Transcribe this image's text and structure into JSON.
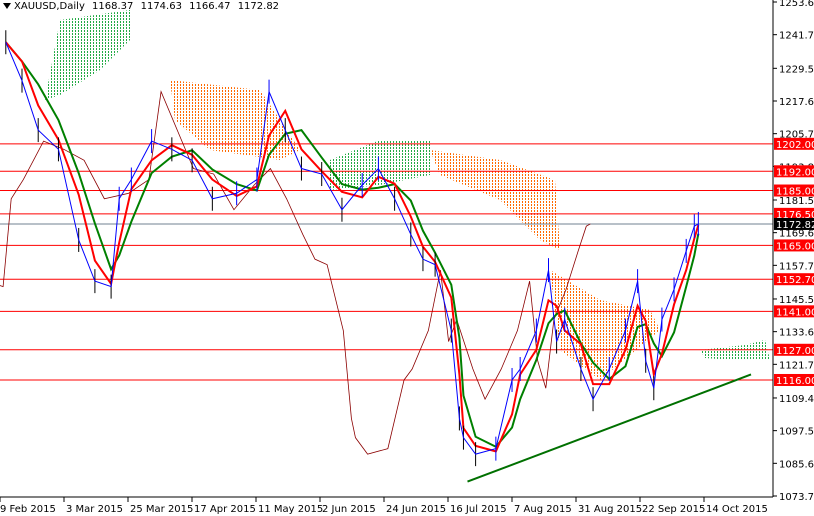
{
  "header": {
    "symbol": "XAUUSD,Daily",
    "open": "1168.37",
    "high": "1174.63",
    "low": "1166.47",
    "close": "1172.82"
  },
  "chart_data": {
    "type": "line",
    "title": "XAUUSD,Daily",
    "ylim": [
      1073.75,
      1253.65
    ],
    "y_ticks": [
      "1253.65",
      "1241.75",
      "1229.50",
      "1217.60",
      "1205.70",
      "1193.80",
      "1181.55",
      "1169.65",
      "1157.75",
      "1145.50",
      "1133.60",
      "1121.70",
      "1109.45",
      "1097.55",
      "1085.65",
      "1073.75"
    ],
    "x_ticks": [
      "9 Feb 2015",
      "3 Mar 2015",
      "25 Mar 2015",
      "17 Apr 2015",
      "11 May 2015",
      "2 Jun 2015",
      "24 Jun 2015",
      "16 Jul 2015",
      "7 Aug 2015",
      "31 Aug 2015",
      "22 Sep 2015",
      "14 Oct 2015"
    ],
    "levels": [
      "1202.00",
      "1192.00",
      "1185.00",
      "1176.50",
      "1165.00",
      "1152.70",
      "1141.00",
      "1127.00",
      "1116.00"
    ],
    "current_price": "1172.82",
    "price_series": {
      "name": "XAUUSD close (approx.)",
      "bar_index": [
        -4,
        0,
        4,
        9,
        14,
        18,
        22,
        24,
        27,
        32,
        37,
        42,
        47,
        53,
        58,
        61,
        65,
        69,
        74,
        79,
        84,
        88,
        92,
        96,
        99,
        102,
        106,
        108,
        109,
        112,
        117,
        121,
        123,
        127,
        130,
        132,
        134,
        138,
        141,
        145,
        149,
        152,
        154,
        156,
        158,
        161,
        164,
        166,
        167
      ],
      "values": [
        1239,
        1225,
        1207,
        1200,
        1167,
        1152,
        1150,
        1182,
        1189,
        1203,
        1200,
        1196,
        1182,
        1184,
        1189,
        1221,
        1207,
        1193,
        1191,
        1178,
        1187,
        1193,
        1182,
        1169,
        1160,
        1158,
        1134,
        1102,
        1095,
        1089,
        1091,
        1116,
        1120,
        1134,
        1156,
        1130,
        1138,
        1120,
        1109,
        1120,
        1134,
        1152,
        1123,
        1113,
        1138,
        1149,
        1163,
        1172,
        1172.82
      ]
    },
    "trendline": {
      "from": [
        110,
        1079
      ],
      "to": [
        180,
        1118
      ]
    },
    "colors": {
      "levels": "#ff0000",
      "tenkan": "#ff0000",
      "kijun": "#008000",
      "chikou": "#8b0000",
      "bars": "#0000ff",
      "trend": "#007000"
    }
  }
}
